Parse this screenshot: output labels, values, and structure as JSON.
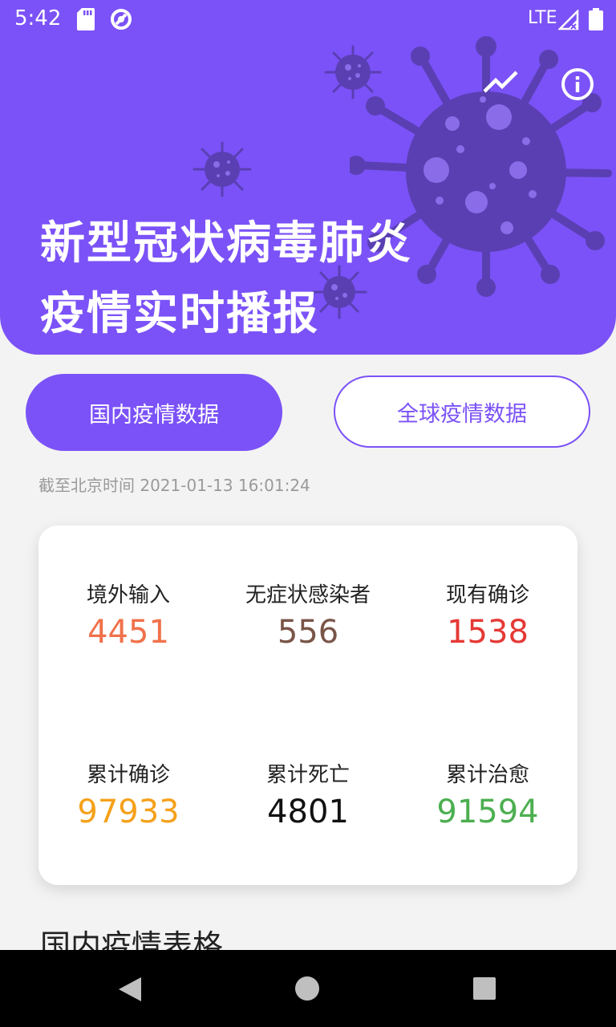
{
  "status_bar": {
    "time": "5:42",
    "network": "LTE"
  },
  "header": {
    "title_line1": "新型冠状病毒肺炎",
    "title_line2": "疫情实时播报",
    "bg_color": "#7b52f7"
  },
  "tabs": {
    "domestic_label": "国内疫情数据",
    "global_label": "全球疫情数据"
  },
  "update_time": "截至北京时间 2021-01-13 16:01:24",
  "stats": [
    {
      "label": "境外输入",
      "value": "4451",
      "color": "#f0714a"
    },
    {
      "label": "无症状感染者",
      "value": "556",
      "color": "#795548"
    },
    {
      "label": "现有确诊",
      "value": "1538",
      "color": "#e53935"
    },
    {
      "label": "累计确诊",
      "value": "97933",
      "color": "#f5a11a"
    },
    {
      "label": "累计死亡",
      "value": "4801",
      "color": "#111111"
    },
    {
      "label": "累计治愈",
      "value": "91594",
      "color": "#4caf50"
    }
  ],
  "section_title": "国内疫情表格",
  "icons": [
    "sd-card-icon",
    "sync-icon",
    "signal-icon",
    "battery-icon",
    "trend-chart-icon",
    "info-icon",
    "virus-icon",
    "back-icon",
    "home-icon",
    "recents-icon"
  ]
}
